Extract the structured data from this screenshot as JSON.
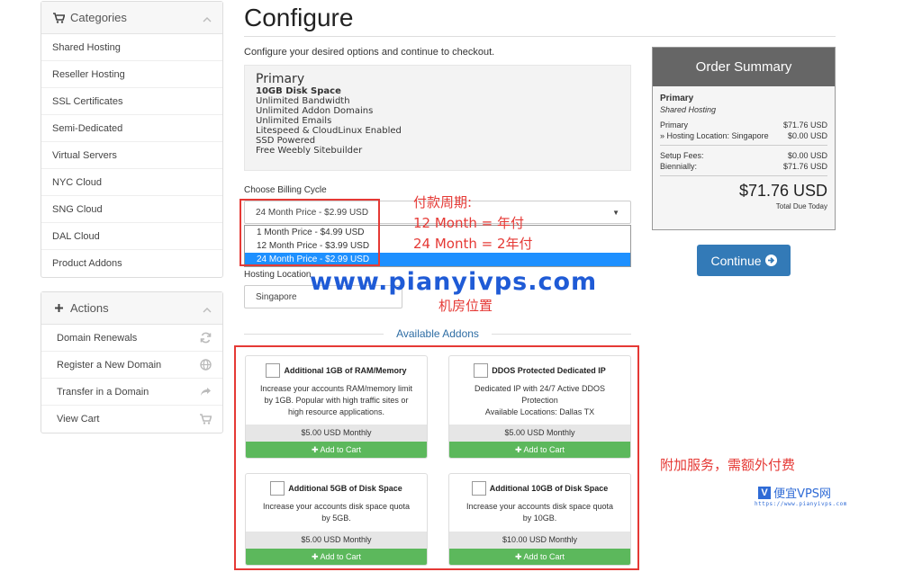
{
  "sidebar": {
    "categories": {
      "title": "Categories",
      "items": [
        "Shared Hosting",
        "Reseller Hosting",
        "SSL Certificates",
        "Semi-Dedicated",
        "Virtual Servers",
        "NYC Cloud",
        "SNG Cloud",
        "DAL Cloud",
        "Product Addons"
      ]
    },
    "actions": {
      "title": "Actions",
      "items": [
        {
          "label": "Domain Renewals",
          "icon": "refresh-icon"
        },
        {
          "label": "Register a New Domain",
          "icon": "globe-icon"
        },
        {
          "label": "Transfer in a Domain",
          "icon": "share-icon"
        },
        {
          "label": "View Cart",
          "icon": "cart-icon"
        }
      ]
    }
  },
  "main": {
    "title": "Configure",
    "subtitle": "Configure your desired options and continue to checkout.",
    "product": {
      "name": "Primary",
      "features": [
        "10GB Disk Space",
        "Unlimited Bandwidth",
        "Unlimited Addon Domains",
        "Unlimited Emails",
        "Litespeed & CloudLinux Enabled",
        "SSD Powered",
        "Free Weebly Sitebuilder"
      ]
    },
    "billing": {
      "label": "Choose Billing Cycle",
      "selected": "24 Month Price - $2.99 USD",
      "options": [
        "1 Month Price - $4.99 USD",
        "12 Month Price - $3.99 USD",
        "24 Month Price - $2.99 USD"
      ]
    },
    "location": {
      "label": "Hosting Location",
      "selected": "Singapore"
    },
    "addons_title": "Available Addons",
    "addons": [
      {
        "name": "Additional 1GB of RAM/Memory",
        "desc": [
          "Increase your accounts RAM/memory limit",
          "by 1GB. Popular with high traffic sites or",
          "high resource applications."
        ],
        "price": "$5.00 USD Monthly",
        "button": "Add to Cart"
      },
      {
        "name": "DDOS Protected Dedicated IP",
        "desc": [
          "Dedicated IP with 24/7 Active DDOS",
          "Protection",
          "Available Locations: Dallas TX"
        ],
        "price": "$5.00 USD Monthly",
        "button": "Add to Cart"
      },
      {
        "name": "Additional 5GB of Disk Space",
        "desc": [
          "Increase your accounts disk space quota",
          "by 5GB."
        ],
        "price": "$5.00 USD Monthly",
        "button": "Add to Cart"
      },
      {
        "name": "Additional 10GB of Disk Space",
        "desc": [
          "Increase your accounts disk space quota",
          "by 10GB."
        ],
        "price": "$10.00 USD Monthly",
        "button": "Add to Cart"
      }
    ]
  },
  "summary": {
    "title": "Order Summary",
    "product": "Primary",
    "group": "Shared Hosting",
    "rows": [
      {
        "label": "Primary",
        "value": "$71.76 USD"
      },
      {
        "label": "» Hosting Location: Singapore",
        "value": "$0.00 USD"
      }
    ],
    "fees": [
      {
        "label": "Setup Fees:",
        "value": "$0.00 USD"
      },
      {
        "label": "Biennially:",
        "value": "$71.76 USD"
      }
    ],
    "total": "$71.76 USD",
    "total_label": "Total Due Today",
    "continue": "Continue"
  },
  "annotations": {
    "billing_note": [
      "付款周期:",
      "12 Month = 年付",
      "24 Month = 2年付"
    ],
    "watermark": "www.pianyivps.com",
    "location_note": "机房位置",
    "addons_note": "附加服务，需额外付费",
    "logo_text": "便宜VPS网",
    "logo_url": "https://www.pianyivps.com"
  },
  "colors": {
    "accent": "#337ab7",
    "green": "#5cb85c",
    "annotation": "#e53935",
    "selected": "#1e90ff"
  }
}
